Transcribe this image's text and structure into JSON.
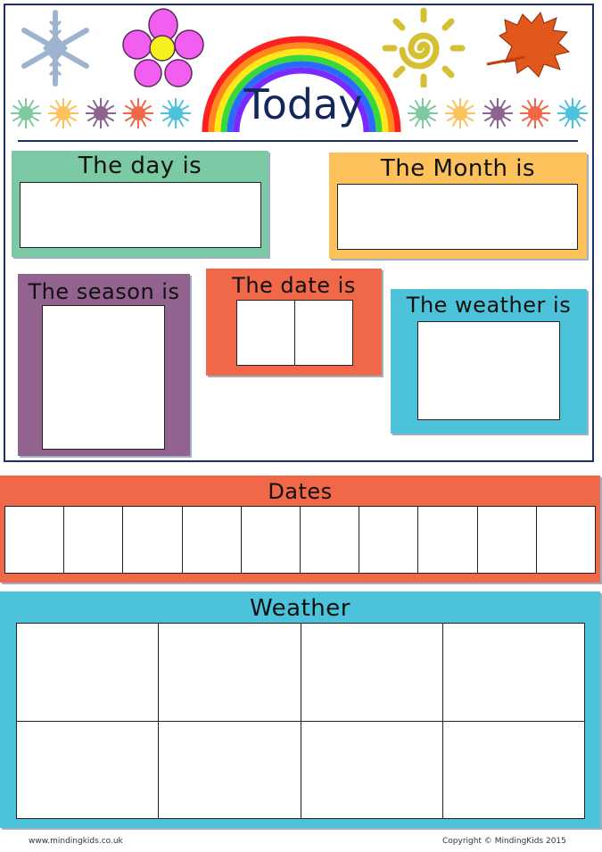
{
  "header": {
    "title": "Today",
    "decorations": [
      "snowflake-icon",
      "flower-icon",
      "rainbow-icon",
      "sun-icon",
      "autumn-leaf-icon"
    ],
    "splat_colors_left": [
      "#7fc9a0",
      "#fcc15a",
      "#8d6490",
      "#f06848",
      "#4cc3da"
    ],
    "splat_colors_right": [
      "#7fc9a0",
      "#fcc15a",
      "#8d6490",
      "#f06848",
      "#4cc3da"
    ]
  },
  "cards": {
    "day": {
      "label": "The day is",
      "color": "#7cc9a5"
    },
    "month": {
      "label": "The Month is",
      "color": "#fcc15a"
    },
    "season": {
      "label": "The season is",
      "color": "#91638e"
    },
    "date": {
      "label": "The date is",
      "color": "#f06848",
      "slots": 2
    },
    "weather": {
      "label": "The weather is",
      "color": "#4cc3da"
    }
  },
  "dates_strip": {
    "label": "Dates",
    "color": "#f06848",
    "slots": 10
  },
  "weather_strip": {
    "label": "Weather",
    "color": "#4cc3da",
    "rows": 2,
    "cols": 4
  },
  "footer": {
    "website": "www.mindingkids.co.uk",
    "copyright": "Copyright © MindingKids 2015"
  }
}
